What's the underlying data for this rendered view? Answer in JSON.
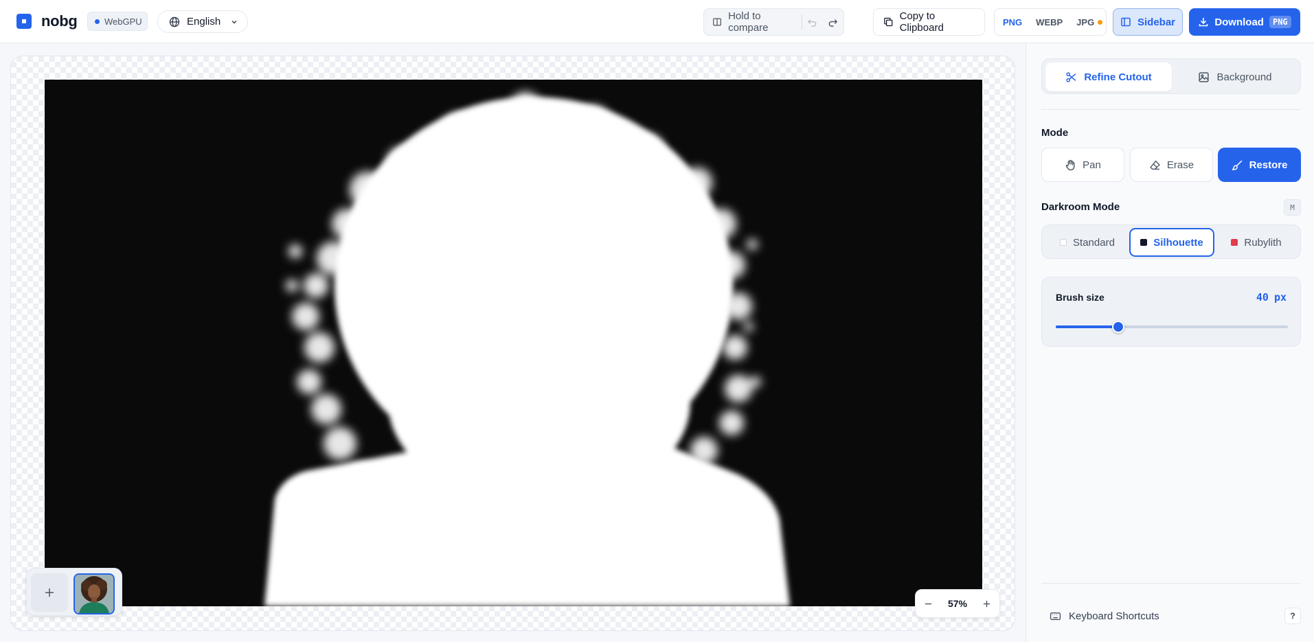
{
  "app": {
    "brand": "nobg",
    "backend_badge": "WebGPU",
    "language": "English"
  },
  "toolbar": {
    "compare_label": "Hold to compare",
    "copy_label": "Copy to Clipboard",
    "formats": [
      "PNG",
      "WEBP",
      "JPG"
    ],
    "selected_format": "PNG",
    "sidebar_label": "Sidebar",
    "download_label": "Download",
    "download_format": "PNG"
  },
  "canvas": {
    "zoom": "57%"
  },
  "panel": {
    "tabs": [
      "Refine Cutout",
      "Background"
    ],
    "active_tab": "Refine Cutout",
    "mode_label": "Mode",
    "modes": [
      "Pan",
      "Erase",
      "Restore"
    ],
    "active_mode": "Restore",
    "darkroom_label": "Darkroom Mode",
    "darkroom_shortcut": "M",
    "darkroom_options": [
      "Standard",
      "Silhouette",
      "Rubylith"
    ],
    "active_darkroom": "Silhouette",
    "brush_label": "Brush size",
    "brush_value": "40",
    "brush_unit": "px",
    "brush_fraction": 0.27,
    "shortcuts_label": "Keyboard Shortcuts",
    "help_key": "?"
  },
  "colors": {
    "accent": "#2563eb",
    "warning_dot": "#f59e0b",
    "rubylith": "#e23c4b"
  }
}
